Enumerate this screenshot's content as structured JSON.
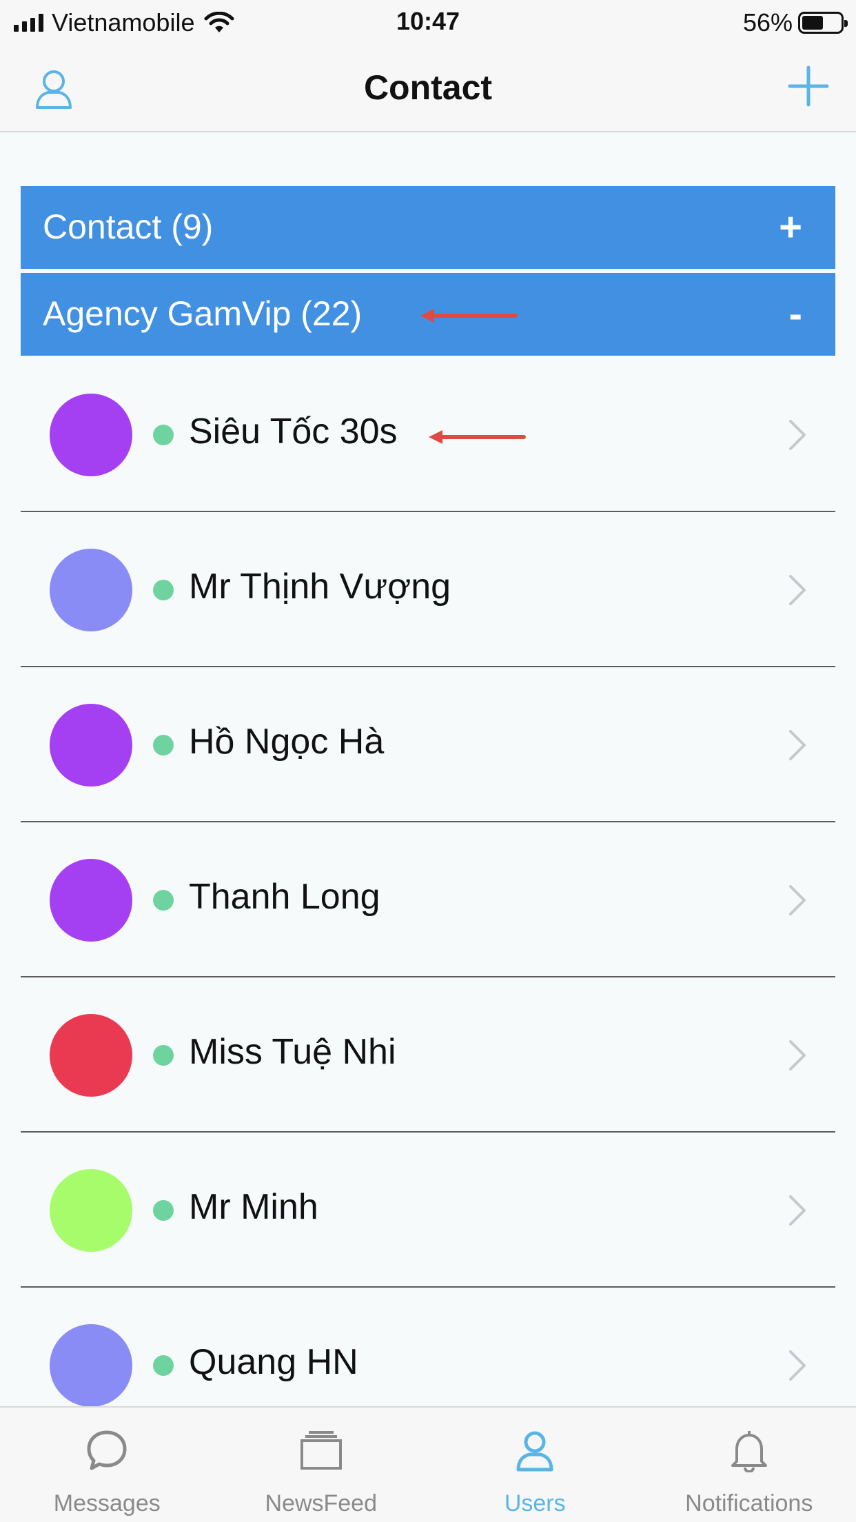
{
  "status_bar": {
    "carrier": "Vietnamobile",
    "time": "10:47",
    "battery": "56%"
  },
  "nav": {
    "title": "Contact"
  },
  "sections": [
    {
      "label": "Contact (9)",
      "toggle": "+"
    },
    {
      "label": "Agency GamVip (22)",
      "toggle": "-"
    }
  ],
  "contacts": [
    {
      "name": "Siêu Tốc 30s",
      "color": "#a540f2"
    },
    {
      "name": "Mr Thịnh Vượng",
      "color": "#8a8cf5"
    },
    {
      "name": "Hồ Ngọc Hà",
      "color": "#a540f2"
    },
    {
      "name": "Thanh Long",
      "color": "#a540f2"
    },
    {
      "name": "Miss Tuệ Nhi",
      "color": "#ea3a52"
    },
    {
      "name": "Mr Minh",
      "color": "#a6fc6a"
    },
    {
      "name": "Quang HN",
      "color": "#8a8cf5"
    }
  ],
  "tabs": [
    {
      "label": "Messages",
      "icon": "chat-bubble-icon",
      "active": false
    },
    {
      "label": "NewsFeed",
      "icon": "stacked-cards-icon",
      "active": false
    },
    {
      "label": "Users",
      "icon": "user-icon",
      "active": true
    },
    {
      "label": "Notifications",
      "icon": "bell-icon",
      "active": false
    }
  ],
  "colors": {
    "section_bg": "#4190e2",
    "accent": "#5ab4e6",
    "online": "#6fd3a0",
    "annotation_arrow": "#e04a45"
  }
}
